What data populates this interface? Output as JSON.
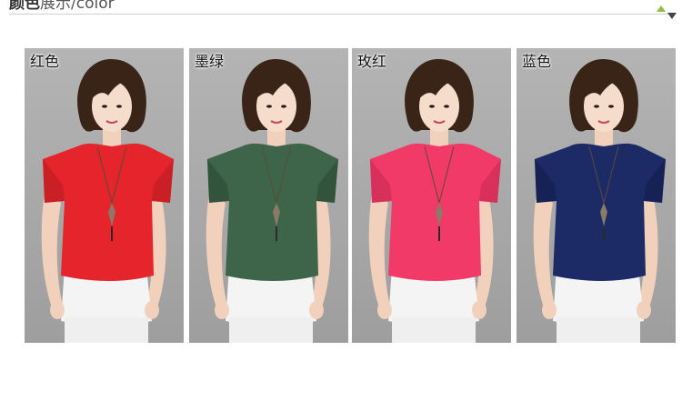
{
  "section_header": {
    "title_strong": "颜色",
    "title_rest": "展示/color"
  },
  "colors": [
    {
      "label": "红色",
      "shirt": "#e5242c",
      "shade": "#b81c22"
    },
    {
      "label": "墨绿",
      "shirt": "#3e6449",
      "shade": "#2c4a35"
    },
    {
      "label": "玫红",
      "shirt": "#f23a69",
      "shade": "#c52a52"
    },
    {
      "label": "蓝色",
      "shirt": "#1c2a66",
      "shade": "#121c4a"
    }
  ]
}
